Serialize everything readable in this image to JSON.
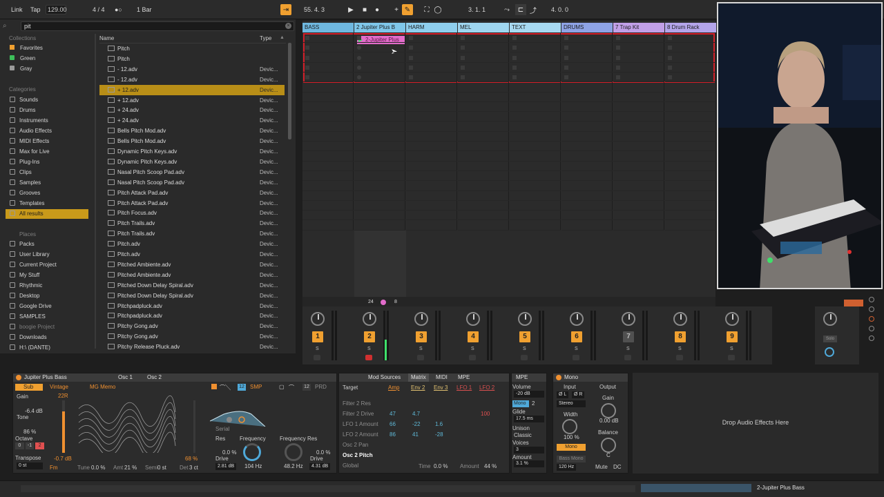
{
  "topbar": {
    "link": "Link",
    "tap": "Tap",
    "tempo": "129.00",
    "signature": "4 / 4",
    "quantize": "1 Bar",
    "position": "55.  4.  3",
    "loop_start": "3.  1.  1",
    "loop_length": "4.  0.  0"
  },
  "browser": {
    "search_value": "pit",
    "collections_title": "Collections",
    "collections": [
      {
        "label": "Favorites",
        "color": "#f0a030"
      },
      {
        "label": "Green",
        "color": "#3dbf5a"
      },
      {
        "label": "Gray",
        "color": "#9a9a9a"
      }
    ],
    "categories_title": "Categories",
    "categories": [
      "Sounds",
      "Drums",
      "Instruments",
      "Audio Effects",
      "MIDI Effects",
      "Max for Live",
      "Plug-Ins",
      "Clips",
      "Samples",
      "Grooves",
      "Templates",
      "All results"
    ],
    "places_title": "Places",
    "places": [
      "Packs",
      "User Library",
      "Current Project",
      "My Stuff",
      "Rhythmic",
      "Desktop",
      "Google Drive",
      "SAMPLES",
      "boogie Project",
      "Downloads",
      "H:\\ (DANTE)"
    ],
    "col_name": "Name",
    "col_type": "Type",
    "files": [
      {
        "name": "Pitch",
        "type": ""
      },
      {
        "name": "Pitch",
        "type": ""
      },
      {
        "name": "- 12.adv",
        "type": "Devic..."
      },
      {
        "name": "- 12.adv",
        "type": "Devic..."
      },
      {
        "name": "+ 12.adv",
        "type": "Devic..."
      },
      {
        "name": "+ 12.adv",
        "type": "Devic..."
      },
      {
        "name": "+ 24.adv",
        "type": "Devic..."
      },
      {
        "name": "+ 24.adv",
        "type": "Devic..."
      },
      {
        "name": "Bells Pitch Mod.adv",
        "type": "Devic..."
      },
      {
        "name": "Bells Pitch Mod.adv",
        "type": "Devic..."
      },
      {
        "name": "Dynamic Pitch Keys.adv",
        "type": "Devic..."
      },
      {
        "name": "Dynamic Pitch Keys.adv",
        "type": "Devic..."
      },
      {
        "name": "Nasal Pitch Scoop Pad.adv",
        "type": "Devic..."
      },
      {
        "name": "Nasal Pitch Scoop Pad.adv",
        "type": "Devic..."
      },
      {
        "name": "Pitch Attack Pad.adv",
        "type": "Devic..."
      },
      {
        "name": "Pitch Attack Pad.adv",
        "type": "Devic..."
      },
      {
        "name": "Pitch Focus.adv",
        "type": "Devic..."
      },
      {
        "name": "Pitch Trails.adv",
        "type": "Devic..."
      },
      {
        "name": "Pitch Trails.adv",
        "type": "Devic..."
      },
      {
        "name": "Pitch.adv",
        "type": "Devic..."
      },
      {
        "name": "Pitch.adv",
        "type": "Devic..."
      },
      {
        "name": "Pitched Ambiente.adv",
        "type": "Devic..."
      },
      {
        "name": "Pitched Ambiente.adv",
        "type": "Devic..."
      },
      {
        "name": "Pitched Down Delay Spiral.adv",
        "type": "Devic..."
      },
      {
        "name": "Pitched Down Delay Spiral.adv",
        "type": "Devic..."
      },
      {
        "name": "Pitchpadpluck.adv",
        "type": "Devic..."
      },
      {
        "name": "Pitchpadpluck.adv",
        "type": "Devic..."
      },
      {
        "name": "Pitchy Gong.adv",
        "type": "Devic..."
      },
      {
        "name": "Pitchy Gong.adv",
        "type": "Devic..."
      },
      {
        "name": "Pitchy Release Pluck.adv",
        "type": "Devic..."
      }
    ]
  },
  "session": {
    "tracks": [
      {
        "name": "BASS",
        "color": "#6fb8e0"
      },
      {
        "name": "2 Jupiter Plus B",
        "color": "#7fc7ea"
      },
      {
        "name": "HARM",
        "color": "#8fcfee"
      },
      {
        "name": "MEL",
        "color": "#9fd6f0"
      },
      {
        "name": "TEXT",
        "color": "#a8daf2"
      },
      {
        "name": "DRUMS",
        "color": "#8ea3e6"
      },
      {
        "name": "7 Trap Kit",
        "color": "#c2a0e8"
      },
      {
        "name": "8 Drum Rack",
        "color": "#b4a5ea"
      }
    ],
    "clip_name": "2-Jupiter Plus",
    "clip_color": "#e36ccb",
    "crossfade_value_a": "24",
    "crossfade_value_b": "8",
    "mixer_numbers": [
      "1",
      "2",
      "3",
      "4",
      "5",
      "6",
      "7",
      "8",
      "9"
    ],
    "solo_label": "S"
  },
  "devices": {
    "synth": {
      "title": "Jupiter Plus Bass",
      "osc1": "Osc 1",
      "osc2": "Osc 2",
      "sub": "Sub",
      "gain": "Gain",
      "gain_val": "-6.4 dB",
      "tone": "Tone",
      "tone_val": "86 %",
      "octave": "Octave",
      "oct_vals": [
        "0",
        "-1",
        "2"
      ],
      "transpose": "Transpose",
      "transpose_val": "0 st",
      "wave_type": "Vintage",
      "wave_name": "MG Memo",
      "pos_val": "22R",
      "low_val": "-0.7 dB",
      "pct_val": "68 %",
      "fm": "Fm",
      "tune": "Tune",
      "tune_val": "0.0 %",
      "amt": "Amt",
      "amt_val": "21 %",
      "semi": "Semi",
      "semi_val": "0 st",
      "det": "Det",
      "det_val": "3 ct",
      "filter_num": "12",
      "smp": "SMP",
      "prd_num": "12",
      "prd": "PRD",
      "serial": "Serial",
      "res": "Res",
      "res_val": "0.0 %",
      "drive": "Drive",
      "drive_val": "2.81 dB",
      "freq": "Frequency",
      "freq_val": "104 Hz",
      "freq_res": "Frequency Res",
      "drive2_val": "0.0 %",
      "drive2": "Drive",
      "freq2_val": "48.2 Hz",
      "drive3_val": "4.31 dB"
    },
    "mod": {
      "tabs": [
        "Mod Sources",
        "Matrix",
        "MIDI",
        "MPE"
      ],
      "target": "Target",
      "sources": [
        "Amp",
        "Env 2",
        "Env 3",
        "LFO 1",
        "LFO 2"
      ],
      "rows": [
        {
          "label": "Filter 2 Res",
          "vals": [
            "",
            "",
            "",
            "",
            ""
          ]
        },
        {
          "label": "Filter 2 Drive",
          "vals": [
            "47",
            "4.7",
            "",
            "",
            "100"
          ]
        },
        {
          "label": "LFO 1 Amount",
          "vals": [
            "66",
            "-22",
            "1.6",
            "",
            ""
          ]
        },
        {
          "label": "LFO 2 Amount",
          "vals": [
            "86",
            "41",
            "-28",
            "",
            ""
          ]
        },
        {
          "label": "Osc 2 Pan",
          "vals": [
            "",
            "",
            "",
            "",
            ""
          ]
        },
        {
          "label": "Osc 2 Pitch",
          "vals": [
            "",
            "",
            "",
            "",
            ""
          ]
        },
        {
          "label": "Global",
          "vals": [
            "",
            "",
            "",
            "",
            ""
          ]
        }
      ],
      "time": "Time",
      "time_val": "0.0 %",
      "amount": "Amount",
      "amount_val": "44 %"
    },
    "voice": {
      "mpe": "MPE",
      "volume": "Volume",
      "volume_val": "-20 dB",
      "mono": "Mono",
      "mono_num": "2",
      "glide": "Glide",
      "glide_val": "17.5 ms",
      "unison": "Unison",
      "unison_mode": "Classic",
      "voices": "Voices",
      "voices_val": "3",
      "amount": "Amount",
      "amount_val": "3.1 %"
    },
    "utility": {
      "title": "Mono",
      "input": "Input",
      "output": "Output",
      "left": "Ø L",
      "right": "Ø R",
      "stereo": "Stereo",
      "width": "Width",
      "width_val": "100 %",
      "gain": "Gain",
      "gain_val": "0.00 dB",
      "balance": "Balance",
      "balance_val": "C",
      "mono_btn": "Mono",
      "bass_mono": "Bass Mono",
      "bass_freq": "120 Hz",
      "mute": "Mute",
      "dc": "DC"
    },
    "drop_hint": "Drop Audio Effects Here"
  },
  "statusbar": {
    "track_name": "2-Jupiter Plus Bass"
  }
}
